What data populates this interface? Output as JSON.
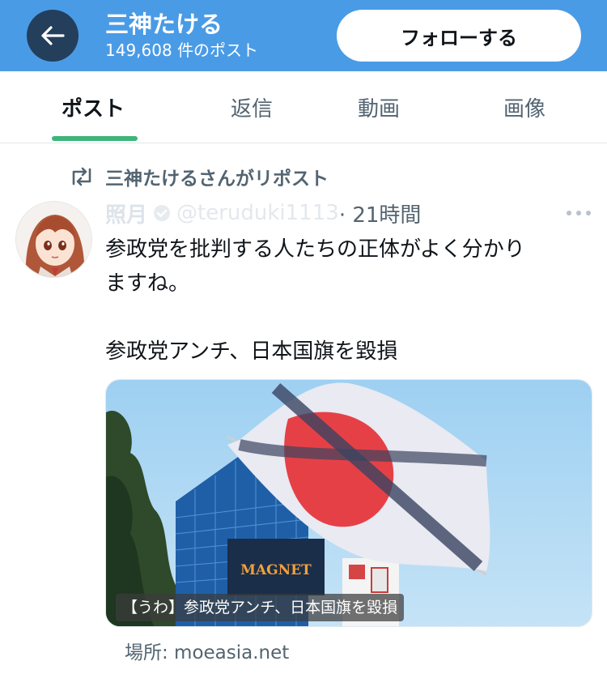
{
  "header": {
    "display_name": "三神たける",
    "post_count": "149,608 件のポスト",
    "follow_label": "フォローする",
    "back_icon": "arrow-left-icon"
  },
  "tabs": [
    {
      "label": "ポスト",
      "active": true
    },
    {
      "label": "返信",
      "active": false
    },
    {
      "label": "動画",
      "active": false
    },
    {
      "label": "画像",
      "active": false
    }
  ],
  "repost": {
    "icon": "repost-icon",
    "label": "三神たけるさんがリポスト"
  },
  "post": {
    "author_name": "照月",
    "handle": "@teruduki1113",
    "time": "· 21時間",
    "lines": [
      "参政党を批判する人たちの正体がよく分かり",
      "ますね。",
      "参政党アンチ、日本国旗を毀損"
    ],
    "media_caption": "【うわ】参政党アンチ、日本国旗を毀損",
    "media_sign_text": "MAGNET",
    "place": "場所: moeasia.net"
  },
  "colors": {
    "header_bg": "#4a9be6",
    "back_button_bg": "#243f5c",
    "tab_indicator": "#3fb47a",
    "secondary_text": "#536471"
  }
}
